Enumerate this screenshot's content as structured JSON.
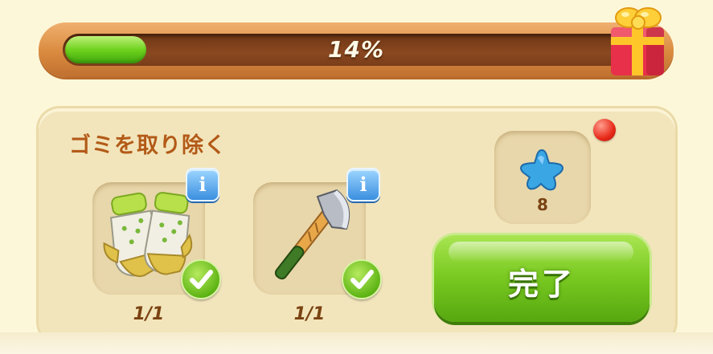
{
  "progress": {
    "label": "14%",
    "value": 0.14
  },
  "gift_icon": "gift-box-icon",
  "task": {
    "title": "ゴミを取り除く",
    "items": [
      {
        "icon": "gloves-icon",
        "count": "1/1",
        "completed": true
      },
      {
        "icon": "axe-icon",
        "count": "1/1",
        "completed": true
      }
    ],
    "info_icon": "info-icon",
    "check_icon": "checkmark-icon"
  },
  "reward": {
    "icon": "blue-star-icon",
    "count": "8"
  },
  "done_button": {
    "label": "完了",
    "notification": true
  },
  "colors": {
    "title_text": "#b35a18",
    "progress_fill": "#6fd21e",
    "done_button": "#7ccb23",
    "notify_dot": "#e82a1a",
    "info_button": "#3a8fe0"
  }
}
